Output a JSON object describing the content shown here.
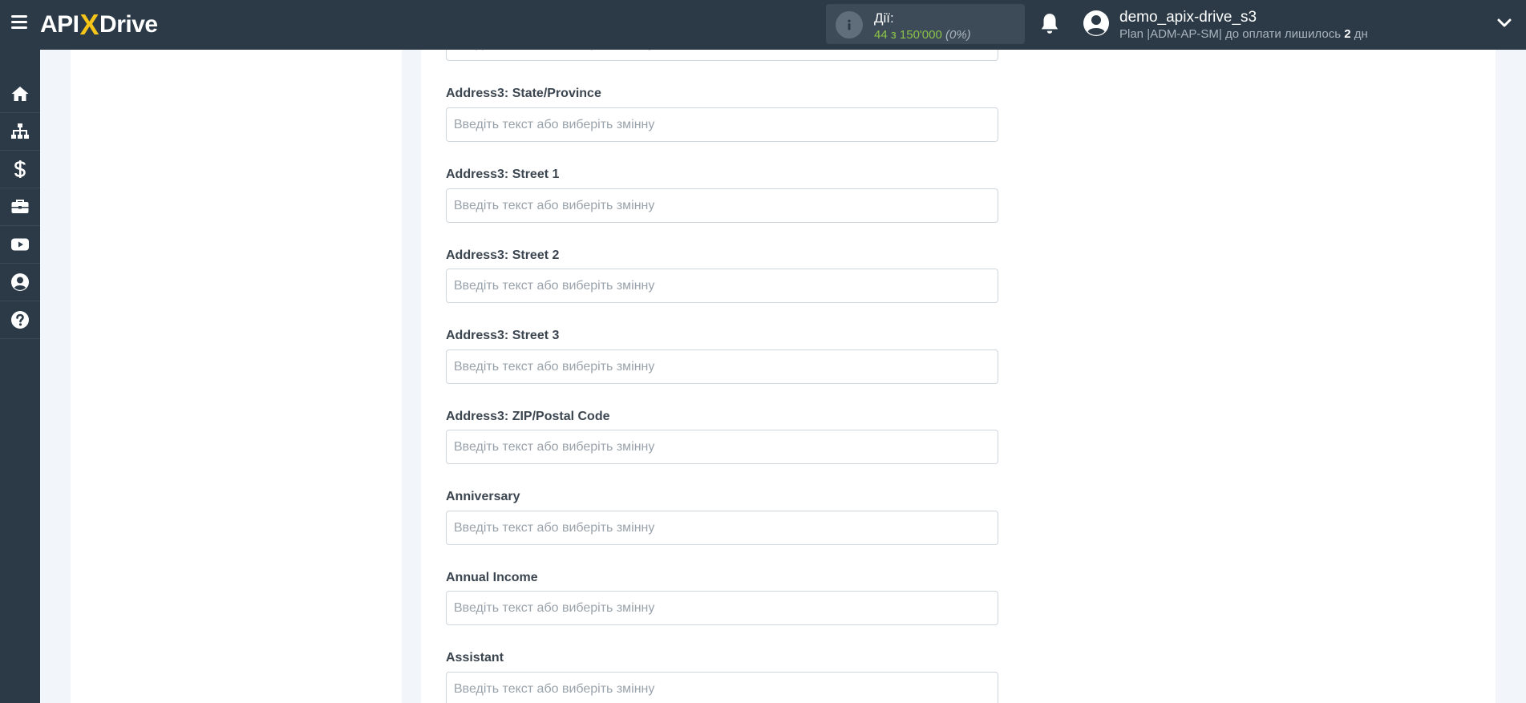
{
  "header": {
    "logo": {
      "left": "API",
      "x": "X",
      "right": "Drive"
    },
    "actions": {
      "title": "Дії:",
      "count": "44 з 150'000",
      "percent": "(0%)"
    },
    "user": {
      "name": "demo_apix-drive_s3",
      "plan_prefix": "Plan |ADM-AP-SM| до оплати лишилось ",
      "days": "2",
      "plan_suffix": " дн"
    }
  },
  "sidebar": {
    "items": [
      {
        "icon": "home-icon"
      },
      {
        "icon": "sitemap-icon"
      },
      {
        "icon": "dollar-icon"
      },
      {
        "icon": "briefcase-icon"
      },
      {
        "icon": "youtube-icon"
      },
      {
        "icon": "user-circle-icon"
      },
      {
        "icon": "help-icon"
      }
    ]
  },
  "form": {
    "placeholder": "Введіть текст або виберіть змінну",
    "fields": [
      {
        "label": ""
      },
      {
        "label": "Address3: State/Province"
      },
      {
        "label": "Address3: Street 1"
      },
      {
        "label": "Address3: Street 2"
      },
      {
        "label": "Address3: Street 3"
      },
      {
        "label": "Address3: ZIP/Postal Code"
      },
      {
        "label": "Anniversary"
      },
      {
        "label": "Annual Income"
      },
      {
        "label": "Assistant"
      }
    ]
  },
  "colors": {
    "topbar": "#2b3a46",
    "accent_yellow": "#f5c518",
    "count_green": "#8bc34a"
  }
}
